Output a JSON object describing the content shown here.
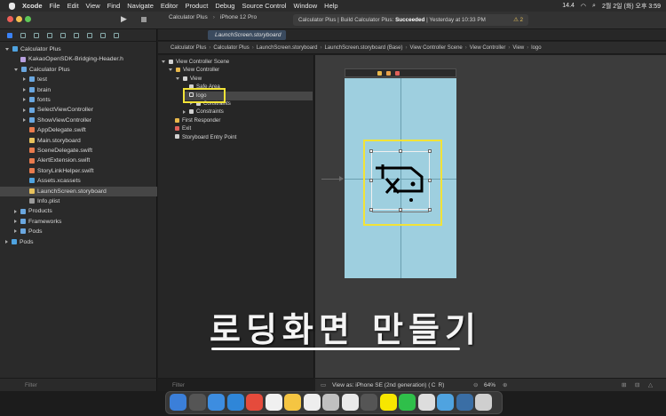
{
  "menubar": {
    "app": "Xcode",
    "items": [
      "File",
      "Edit",
      "View",
      "Find",
      "Navigate",
      "Editor",
      "Product",
      "Debug",
      "Source Control",
      "Window",
      "Help"
    ],
    "network": "14.4",
    "datetime": "2월 2일 (화) 오후 3:59"
  },
  "toolbar": {
    "scheme": "Calculator Plus",
    "device": "iPhone 12 Pro",
    "status_prefix": "Calculator Plus | Build Calculator Plus:",
    "status_result": "Succeeded",
    "status_time": "| Yesterday at 10:33 PM",
    "warnings": "2"
  },
  "navigator": {
    "rows": [
      {
        "label": "Calculator Plus",
        "indent": 0,
        "icon": "file-a",
        "disc": "open"
      },
      {
        "label": "KakaoOpenSDK-Bridging-Header.h",
        "indent": 1,
        "icon": "file-h",
        "disc": ""
      },
      {
        "label": "Calculator Plus",
        "indent": 1,
        "icon": "folder",
        "disc": "open"
      },
      {
        "label": "test",
        "indent": 2,
        "icon": "folder",
        "disc": "closed"
      },
      {
        "label": "brain",
        "indent": 2,
        "icon": "folder",
        "disc": "closed"
      },
      {
        "label": "fonts",
        "indent": 2,
        "icon": "folder",
        "disc": "closed"
      },
      {
        "label": "SelectViewController",
        "indent": 2,
        "icon": "folder",
        "disc": "closed"
      },
      {
        "label": "ShowViewController",
        "indent": 2,
        "icon": "folder",
        "disc": "closed"
      },
      {
        "label": "AppDelegate.swift",
        "indent": 2,
        "icon": "file-s",
        "disc": ""
      },
      {
        "label": "Main.storyboard",
        "indent": 2,
        "icon": "file-sb",
        "disc": ""
      },
      {
        "label": "SceneDelegate.swift",
        "indent": 2,
        "icon": "file-s",
        "disc": ""
      },
      {
        "label": "AlertExtension.swift",
        "indent": 2,
        "icon": "file-s",
        "disc": ""
      },
      {
        "label": "StoryLinkHelper.swift",
        "indent": 2,
        "icon": "file-s",
        "disc": ""
      },
      {
        "label": "Assets.xcassets",
        "indent": 2,
        "icon": "file-a",
        "disc": ""
      },
      {
        "label": "LaunchScreen.storyboard",
        "indent": 2,
        "icon": "file-sb",
        "disc": "",
        "selected": true
      },
      {
        "label": "Info.plist",
        "indent": 2,
        "icon": "file-p",
        "disc": ""
      },
      {
        "label": "Products",
        "indent": 1,
        "icon": "folder",
        "disc": "closed"
      },
      {
        "label": "Frameworks",
        "indent": 1,
        "icon": "folder",
        "disc": "closed"
      },
      {
        "label": "Pods",
        "indent": 1,
        "icon": "folder",
        "disc": "closed"
      },
      {
        "label": "Pods",
        "indent": 0,
        "icon": "file-a",
        "disc": "closed"
      }
    ],
    "filter_placeholder": "Filter"
  },
  "editor": {
    "tab_label": "LaunchScreen.storyboard",
    "jumpbar": [
      "Calculator Plus",
      "Calculator Plus",
      "LaunchScreen.storyboard",
      "LaunchScreen.storyboard (Base)",
      "View Controller Scene",
      "View Controller",
      "View",
      "logo"
    ]
  },
  "outline": {
    "rows": [
      {
        "label": "View Controller Scene",
        "indent": 0,
        "icon": "",
        "disc": "open"
      },
      {
        "label": "View Controller",
        "indent": 1,
        "icon": "yel",
        "disc": "open"
      },
      {
        "label": "View",
        "indent": 2,
        "icon": "",
        "disc": "open"
      },
      {
        "label": "Safe Area",
        "indent": 3,
        "icon": "",
        "disc": ""
      },
      {
        "label": "logo",
        "indent": 3,
        "icon": "img",
        "disc": "",
        "selected": true
      },
      {
        "label": "Constraints",
        "indent": 4,
        "icon": "",
        "disc": "closed"
      },
      {
        "label": "Constraints",
        "indent": 3,
        "icon": "",
        "disc": "closed"
      },
      {
        "label": "First Responder",
        "indent": 1,
        "icon": "yel",
        "disc": ""
      },
      {
        "label": "Exit",
        "indent": 1,
        "icon": "red",
        "disc": ""
      },
      {
        "label": "Storyboard Entry Point",
        "indent": 1,
        "icon": "",
        "disc": ""
      }
    ],
    "filter_placeholder": "Filter"
  },
  "canvas": {
    "overlay_title": "로딩화면 만들기",
    "view_as": "View as: iPhone SE (2nd generation) ( C  R)",
    "zoom": "64%"
  },
  "dock": {
    "icon_colors": [
      "#3b7fd9",
      "#555555",
      "#3d8de0",
      "#2f86d8",
      "#e54b3c",
      "#f0f0f0",
      "#f5c542",
      "#eeeeee",
      "#c0c0c0",
      "#e9e9e9",
      "#555555",
      "#f7e600",
      "#2fbf4a",
      "#dddddd",
      "#4fa3e0",
      "#3a6ea5",
      "#cfcfcf"
    ]
  }
}
